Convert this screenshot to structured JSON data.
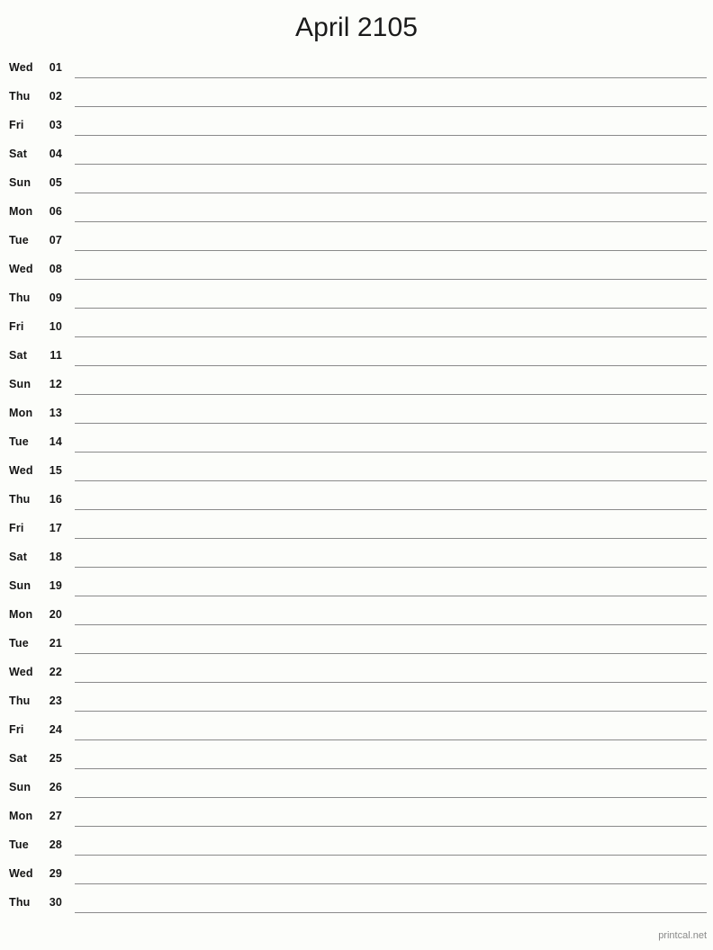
{
  "document": {
    "title": "April 2105",
    "type": "monthly-notes-calendar"
  },
  "footer": {
    "text": "printcal.net"
  },
  "colors": {
    "background": "#fcfdfa",
    "text": "#151515",
    "rule": "#8a8a8a",
    "footer_text": "#8a8a8a"
  },
  "rows": [
    {
      "dow": "Wed",
      "day": "01"
    },
    {
      "dow": "Thu",
      "day": "02"
    },
    {
      "dow": "Fri",
      "day": "03"
    },
    {
      "dow": "Sat",
      "day": "04"
    },
    {
      "dow": "Sun",
      "day": "05"
    },
    {
      "dow": "Mon",
      "day": "06"
    },
    {
      "dow": "Tue",
      "day": "07"
    },
    {
      "dow": "Wed",
      "day": "08"
    },
    {
      "dow": "Thu",
      "day": "09"
    },
    {
      "dow": "Fri",
      "day": "10"
    },
    {
      "dow": "Sat",
      "day": "11"
    },
    {
      "dow": "Sun",
      "day": "12"
    },
    {
      "dow": "Mon",
      "day": "13"
    },
    {
      "dow": "Tue",
      "day": "14"
    },
    {
      "dow": "Wed",
      "day": "15"
    },
    {
      "dow": "Thu",
      "day": "16"
    },
    {
      "dow": "Fri",
      "day": "17"
    },
    {
      "dow": "Sat",
      "day": "18"
    },
    {
      "dow": "Sun",
      "day": "19"
    },
    {
      "dow": "Mon",
      "day": "20"
    },
    {
      "dow": "Tue",
      "day": "21"
    },
    {
      "dow": "Wed",
      "day": "22"
    },
    {
      "dow": "Thu",
      "day": "23"
    },
    {
      "dow": "Fri",
      "day": "24"
    },
    {
      "dow": "Sat",
      "day": "25"
    },
    {
      "dow": "Sun",
      "day": "26"
    },
    {
      "dow": "Mon",
      "day": "27"
    },
    {
      "dow": "Tue",
      "day": "28"
    },
    {
      "dow": "Wed",
      "day": "29"
    },
    {
      "dow": "Thu",
      "day": "30"
    }
  ]
}
